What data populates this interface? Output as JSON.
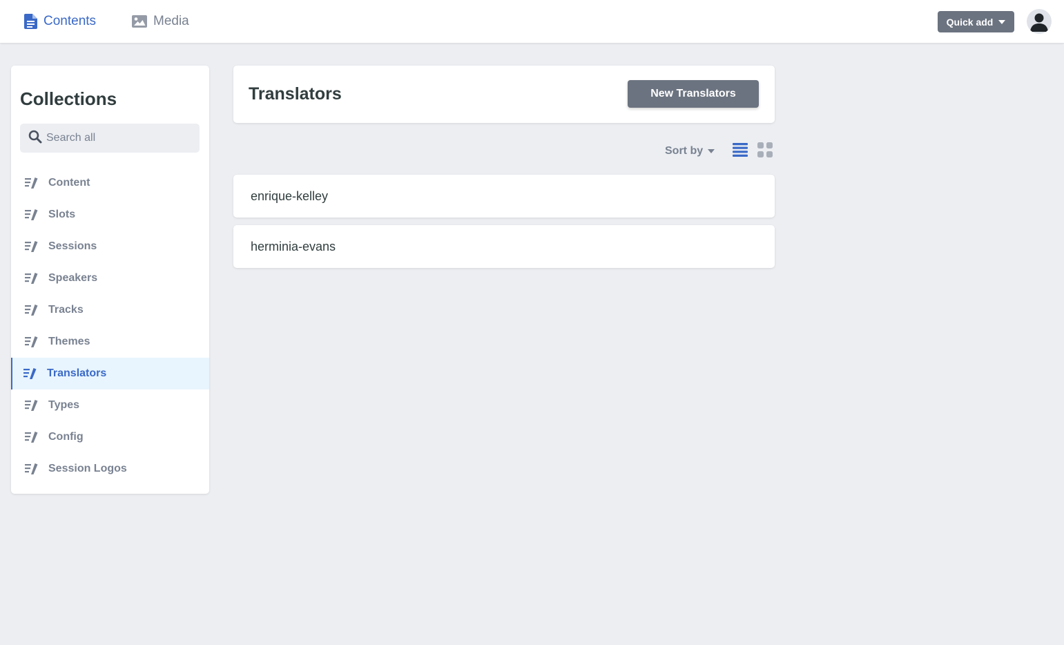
{
  "topbar": {
    "tabs": [
      {
        "label": "Contents",
        "icon": "document-icon",
        "active": true
      },
      {
        "label": "Media",
        "icon": "image-icon",
        "active": false
      }
    ],
    "quick_add_label": "Quick add"
  },
  "sidebar": {
    "title": "Collections",
    "search_placeholder": "Search all",
    "items": [
      {
        "label": "Content"
      },
      {
        "label": "Slots"
      },
      {
        "label": "Sessions"
      },
      {
        "label": "Speakers"
      },
      {
        "label": "Tracks"
      },
      {
        "label": "Themes"
      },
      {
        "label": "Translators",
        "active": true
      },
      {
        "label": "Types"
      },
      {
        "label": "Config"
      },
      {
        "label": "Session Logos"
      }
    ]
  },
  "main": {
    "title": "Translators",
    "new_button_label": "New Translators",
    "sort_label": "Sort by",
    "view_mode": "list",
    "entries": [
      {
        "title": "enrique-kelley"
      },
      {
        "title": "herminia-evans"
      }
    ]
  },
  "colors": {
    "accent": "#3a69c7",
    "active_bg": "#e8f5fe",
    "button_bg": "#6b7380",
    "muted_text": "#798291",
    "page_bg": "#eceef2"
  }
}
